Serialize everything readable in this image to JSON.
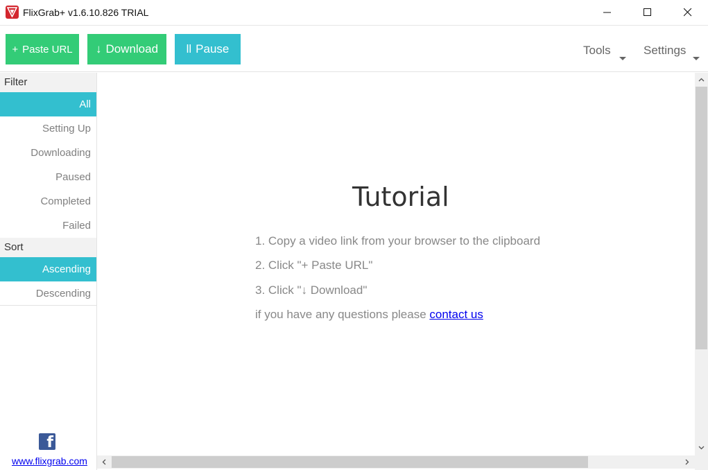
{
  "window": {
    "title": "FlixGrab+ v1.6.10.826 TRIAL",
    "icons": {
      "logo": "flixgrab-logo-icon",
      "minimize": "minimize-icon",
      "maximize": "maximize-icon",
      "close": "close-icon"
    }
  },
  "toolbar": {
    "paste_glyph": "+",
    "paste_label": "Paste URL",
    "download_glyph": "↓",
    "download_label": "Download",
    "pause_glyph": "ll",
    "pause_label": "Pause",
    "tools_label": "Tools",
    "settings_label": "Settings",
    "colors": {
      "green": "#33cc77",
      "teal": "#33bfcf"
    }
  },
  "sidebar": {
    "filter_header": "Filter",
    "filter_items": [
      {
        "label": "All",
        "active": true
      },
      {
        "label": "Setting Up",
        "active": false
      },
      {
        "label": "Downloading",
        "active": false
      },
      {
        "label": "Paused",
        "active": false
      },
      {
        "label": "Completed",
        "active": false
      },
      {
        "label": "Failed",
        "active": false
      }
    ],
    "sort_header": "Sort",
    "sort_items": [
      {
        "label": "Ascending",
        "active": true
      },
      {
        "label": "Descending",
        "active": false
      }
    ],
    "facebook_icon": "facebook-icon",
    "site_link": "www.flixgrab.com"
  },
  "tutorial": {
    "title": "Tutorial",
    "step1": "1. Copy a video link from your browser to the clipboard",
    "step2": "2. Click \"+ Paste URL\"",
    "step3": "3. Click \"↓ Download\"",
    "question_prefix": "if you have any questions please ",
    "contact_label": "contact us"
  }
}
